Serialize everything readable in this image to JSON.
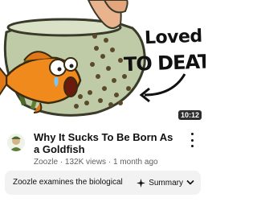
{
  "video": {
    "thumbnail": {
      "overlay_line1": "Loved",
      "overlay_line2": "TO DEATH",
      "duration": "10:12"
    },
    "title": "Why It Sucks To Be Born As a Goldfish",
    "channel": "Zoozle",
    "views": "132K views",
    "age": "1 month ago",
    "separator": "·"
  },
  "summary": {
    "text": "Zoozle examines the biological re...",
    "button_label": "Summary"
  },
  "icons": {
    "summary": "sparkle-icon",
    "expand": "chevron-down-icon",
    "menu": "more-vert-icon"
  },
  "colors": {
    "fish": "#f08a1c",
    "water": "#b9c8a0",
    "pellets": "#5a4a2a"
  }
}
